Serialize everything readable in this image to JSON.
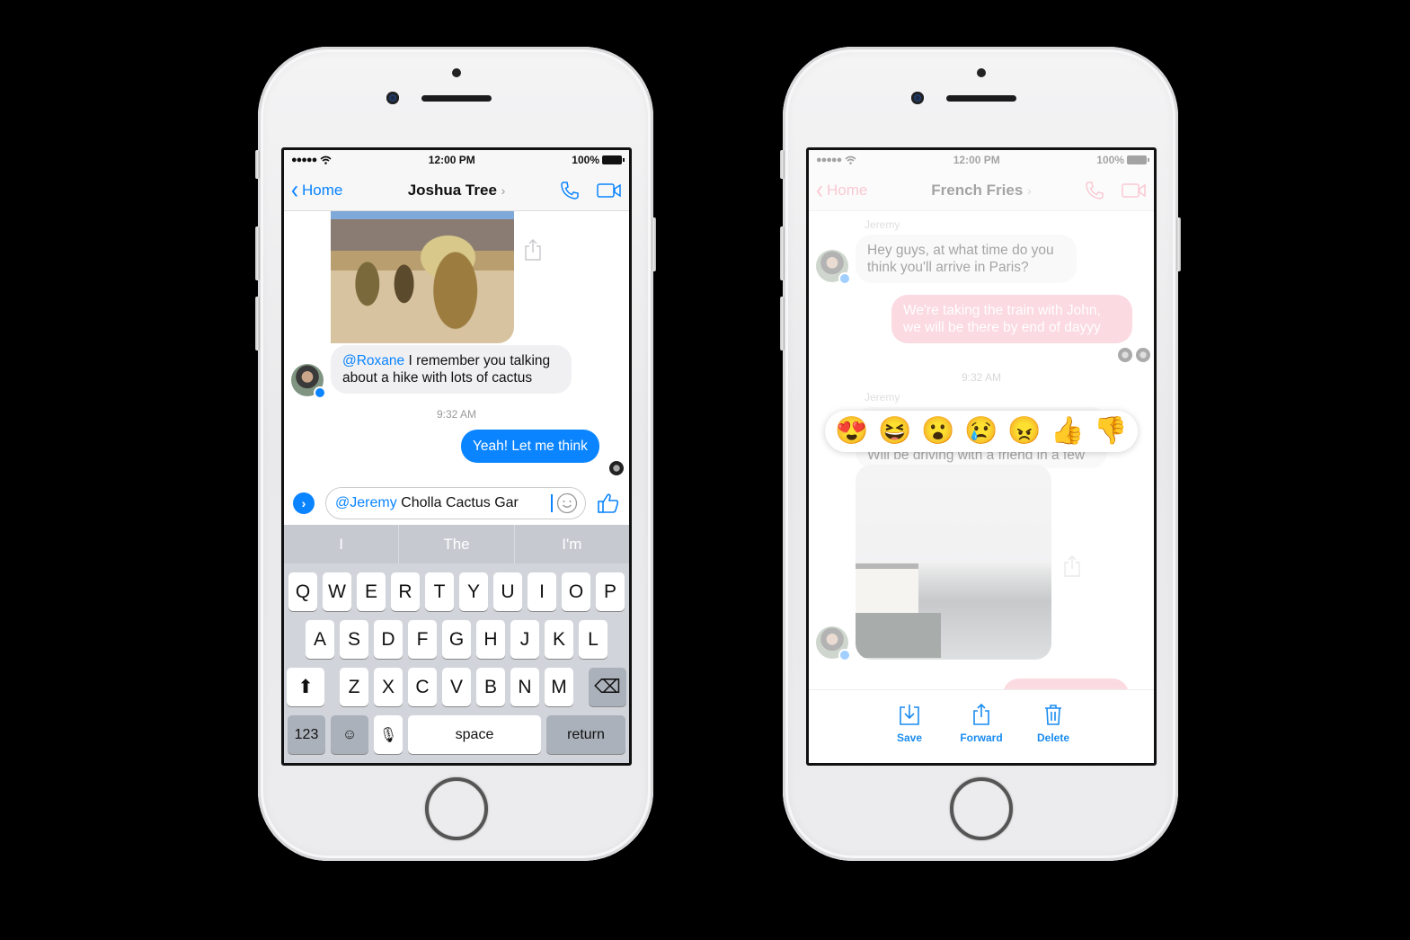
{
  "left_phone": {
    "status": {
      "signal": "●●●●●",
      "time": "12:00 PM",
      "battery": "100%"
    },
    "nav": {
      "back_label": "Home",
      "title": "Joshua Tree",
      "title_chevron": "›"
    },
    "messages": {
      "incoming_mention": "@Roxane",
      "incoming_text": " I remember you talking about a hike with lots of cactus",
      "timestamp": "9:32 AM",
      "outgoing_text": "Yeah! Let me think"
    },
    "composer": {
      "expand_glyph": "›",
      "mention": "@Jeremy",
      "value": "Cholla Cactus Gar"
    },
    "keyboard": {
      "suggestions": [
        "I",
        "The",
        "I'm"
      ],
      "row1": [
        "Q",
        "W",
        "E",
        "R",
        "T",
        "Y",
        "U",
        "I",
        "O",
        "P"
      ],
      "row2": [
        "A",
        "S",
        "D",
        "F",
        "G",
        "H",
        "J",
        "K",
        "L"
      ],
      "row3": [
        "Z",
        "X",
        "C",
        "V",
        "B",
        "N",
        "M"
      ],
      "numbers_label": "123",
      "space_label": "space",
      "return_label": "return",
      "shift_glyph": "⬆",
      "emoji_glyph": "☺",
      "mic_glyph": "🎙",
      "delete_glyph": "⌫"
    }
  },
  "right_phone": {
    "status": {
      "signal": "●●●●●",
      "time": "12:00 PM",
      "battery": "100%"
    },
    "nav": {
      "back_label": "Home",
      "title": "French Fries",
      "title_chevron": "›"
    },
    "messages": {
      "sender1": "Jeremy",
      "incoming_text": "Hey guys, at what time do you think you'll arrive in Paris?",
      "outgoing_text": "We're taking the train with John, we will be there by end of dayyy",
      "timestamp": "9:32 AM",
      "sender2": "Jeremy",
      "incoming_text2": "Will be driving with a friend in a few"
    },
    "reactions": [
      {
        "name": "love",
        "glyph": "😍"
      },
      {
        "name": "haha",
        "glyph": "😆"
      },
      {
        "name": "wow",
        "glyph": "😮"
      },
      {
        "name": "sad",
        "glyph": "😢"
      },
      {
        "name": "angry",
        "glyph": "😠"
      },
      {
        "name": "like",
        "glyph": "👍"
      },
      {
        "name": "dislike",
        "glyph": "👎"
      }
    ],
    "actions": {
      "save": "Save",
      "forward": "Forward",
      "delete": "Delete"
    }
  },
  "colors": {
    "messenger_blue": "#0a84ff",
    "pink": "#f6a0b1",
    "action_blue": "#1a8cf0"
  }
}
